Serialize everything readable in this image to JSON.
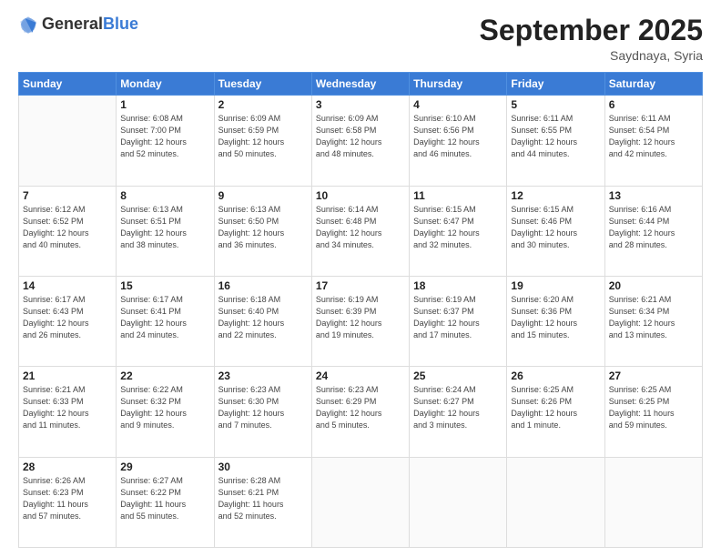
{
  "logo": {
    "general": "General",
    "blue": "Blue"
  },
  "header": {
    "month": "September 2025",
    "location": "Saydnaya, Syria"
  },
  "weekdays": [
    "Sunday",
    "Monday",
    "Tuesday",
    "Wednesday",
    "Thursday",
    "Friday",
    "Saturday"
  ],
  "weeks": [
    [
      {
        "day": "",
        "info": ""
      },
      {
        "day": "1",
        "info": "Sunrise: 6:08 AM\nSunset: 7:00 PM\nDaylight: 12 hours\nand 52 minutes."
      },
      {
        "day": "2",
        "info": "Sunrise: 6:09 AM\nSunset: 6:59 PM\nDaylight: 12 hours\nand 50 minutes."
      },
      {
        "day": "3",
        "info": "Sunrise: 6:09 AM\nSunset: 6:58 PM\nDaylight: 12 hours\nand 48 minutes."
      },
      {
        "day": "4",
        "info": "Sunrise: 6:10 AM\nSunset: 6:56 PM\nDaylight: 12 hours\nand 46 minutes."
      },
      {
        "day": "5",
        "info": "Sunrise: 6:11 AM\nSunset: 6:55 PM\nDaylight: 12 hours\nand 44 minutes."
      },
      {
        "day": "6",
        "info": "Sunrise: 6:11 AM\nSunset: 6:54 PM\nDaylight: 12 hours\nand 42 minutes."
      }
    ],
    [
      {
        "day": "7",
        "info": "Sunrise: 6:12 AM\nSunset: 6:52 PM\nDaylight: 12 hours\nand 40 minutes."
      },
      {
        "day": "8",
        "info": "Sunrise: 6:13 AM\nSunset: 6:51 PM\nDaylight: 12 hours\nand 38 minutes."
      },
      {
        "day": "9",
        "info": "Sunrise: 6:13 AM\nSunset: 6:50 PM\nDaylight: 12 hours\nand 36 minutes."
      },
      {
        "day": "10",
        "info": "Sunrise: 6:14 AM\nSunset: 6:48 PM\nDaylight: 12 hours\nand 34 minutes."
      },
      {
        "day": "11",
        "info": "Sunrise: 6:15 AM\nSunset: 6:47 PM\nDaylight: 12 hours\nand 32 minutes."
      },
      {
        "day": "12",
        "info": "Sunrise: 6:15 AM\nSunset: 6:46 PM\nDaylight: 12 hours\nand 30 minutes."
      },
      {
        "day": "13",
        "info": "Sunrise: 6:16 AM\nSunset: 6:44 PM\nDaylight: 12 hours\nand 28 minutes."
      }
    ],
    [
      {
        "day": "14",
        "info": "Sunrise: 6:17 AM\nSunset: 6:43 PM\nDaylight: 12 hours\nand 26 minutes."
      },
      {
        "day": "15",
        "info": "Sunrise: 6:17 AM\nSunset: 6:41 PM\nDaylight: 12 hours\nand 24 minutes."
      },
      {
        "day": "16",
        "info": "Sunrise: 6:18 AM\nSunset: 6:40 PM\nDaylight: 12 hours\nand 22 minutes."
      },
      {
        "day": "17",
        "info": "Sunrise: 6:19 AM\nSunset: 6:39 PM\nDaylight: 12 hours\nand 19 minutes."
      },
      {
        "day": "18",
        "info": "Sunrise: 6:19 AM\nSunset: 6:37 PM\nDaylight: 12 hours\nand 17 minutes."
      },
      {
        "day": "19",
        "info": "Sunrise: 6:20 AM\nSunset: 6:36 PM\nDaylight: 12 hours\nand 15 minutes."
      },
      {
        "day": "20",
        "info": "Sunrise: 6:21 AM\nSunset: 6:34 PM\nDaylight: 12 hours\nand 13 minutes."
      }
    ],
    [
      {
        "day": "21",
        "info": "Sunrise: 6:21 AM\nSunset: 6:33 PM\nDaylight: 12 hours\nand 11 minutes."
      },
      {
        "day": "22",
        "info": "Sunrise: 6:22 AM\nSunset: 6:32 PM\nDaylight: 12 hours\nand 9 minutes."
      },
      {
        "day": "23",
        "info": "Sunrise: 6:23 AM\nSunset: 6:30 PM\nDaylight: 12 hours\nand 7 minutes."
      },
      {
        "day": "24",
        "info": "Sunrise: 6:23 AM\nSunset: 6:29 PM\nDaylight: 12 hours\nand 5 minutes."
      },
      {
        "day": "25",
        "info": "Sunrise: 6:24 AM\nSunset: 6:27 PM\nDaylight: 12 hours\nand 3 minutes."
      },
      {
        "day": "26",
        "info": "Sunrise: 6:25 AM\nSunset: 6:26 PM\nDaylight: 12 hours\nand 1 minute."
      },
      {
        "day": "27",
        "info": "Sunrise: 6:25 AM\nSunset: 6:25 PM\nDaylight: 11 hours\nand 59 minutes."
      }
    ],
    [
      {
        "day": "28",
        "info": "Sunrise: 6:26 AM\nSunset: 6:23 PM\nDaylight: 11 hours\nand 57 minutes."
      },
      {
        "day": "29",
        "info": "Sunrise: 6:27 AM\nSunset: 6:22 PM\nDaylight: 11 hours\nand 55 minutes."
      },
      {
        "day": "30",
        "info": "Sunrise: 6:28 AM\nSunset: 6:21 PM\nDaylight: 11 hours\nand 52 minutes."
      },
      {
        "day": "",
        "info": ""
      },
      {
        "day": "",
        "info": ""
      },
      {
        "day": "",
        "info": ""
      },
      {
        "day": "",
        "info": ""
      }
    ]
  ]
}
